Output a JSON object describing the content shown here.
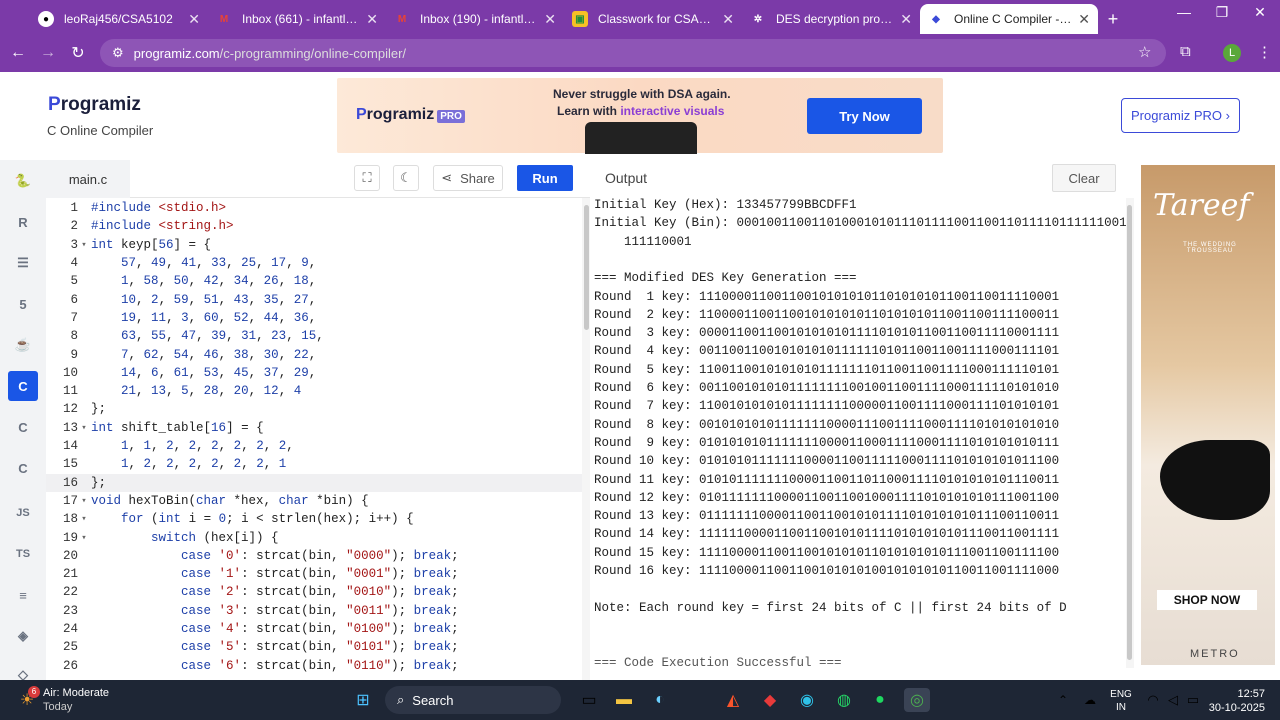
{
  "browser": {
    "tabs": [
      {
        "label": "leoRaj456/CSA5102",
        "icon": "github-icon"
      },
      {
        "label": "Inbox (661) - infantleoraj19",
        "icon": "gmail-icon"
      },
      {
        "label": "Inbox (190) - infantleoraj",
        "icon": "gmail-icon"
      },
      {
        "label": "Classwork for CSA5102_CN",
        "icon": "classroom-icon"
      },
      {
        "label": "DES decryption program",
        "icon": "chatgpt-icon"
      },
      {
        "label": "Online C Compiler - Progra",
        "icon": "programiz-icon"
      }
    ],
    "active_tab": 5,
    "url_domain": "programiz.com",
    "url_path": "/c-programming/online-compiler/",
    "profile_initial": "L"
  },
  "site": {
    "logo": "rogramiz",
    "logo_p": "P",
    "subtitle": "C Online Compiler",
    "pro_button": "Programiz PRO ›",
    "ad": {
      "logo": "rogramiz",
      "logo_p": "P",
      "pro": "PRO",
      "line1": "Never struggle with DSA again.",
      "line2_a": "Learn with ",
      "line2_b": "interactive visuals",
      "cta": "Try Now"
    }
  },
  "editor": {
    "filename": "main.c",
    "share": "Share",
    "run": "Run",
    "lines": [
      {
        "n": "1",
        "f": "",
        "html": "<span class='k'>#include</span> <span class='s'>&lt;stdio.h&gt;</span>"
      },
      {
        "n": "2",
        "f": "",
        "html": "<span class='k'>#include</span> <span class='s'>&lt;string.h&gt;</span>"
      },
      {
        "n": "3",
        "f": "▾",
        "html": "<span class='k'>int</span> keyp[<span class='n'>56</span>] = {"
      },
      {
        "n": "4",
        "f": "",
        "html": "    <span class='n'>57</span>, <span class='n'>49</span>, <span class='n'>41</span>, <span class='n'>33</span>, <span class='n'>25</span>, <span class='n'>17</span>, <span class='n'>9</span>,"
      },
      {
        "n": "5",
        "f": "",
        "html": "    <span class='n'>1</span>, <span class='n'>58</span>, <span class='n'>50</span>, <span class='n'>42</span>, <span class='n'>34</span>, <span class='n'>26</span>, <span class='n'>18</span>,"
      },
      {
        "n": "6",
        "f": "",
        "html": "    <span class='n'>10</span>, <span class='n'>2</span>, <span class='n'>59</span>, <span class='n'>51</span>, <span class='n'>43</span>, <span class='n'>35</span>, <span class='n'>27</span>,"
      },
      {
        "n": "7",
        "f": "",
        "html": "    <span class='n'>19</span>, <span class='n'>11</span>, <span class='n'>3</span>, <span class='n'>60</span>, <span class='n'>52</span>, <span class='n'>44</span>, <span class='n'>36</span>,"
      },
      {
        "n": "8",
        "f": "",
        "html": "    <span class='n'>63</span>, <span class='n'>55</span>, <span class='n'>47</span>, <span class='n'>39</span>, <span class='n'>31</span>, <span class='n'>23</span>, <span class='n'>15</span>,"
      },
      {
        "n": "9",
        "f": "",
        "html": "    <span class='n'>7</span>, <span class='n'>62</span>, <span class='n'>54</span>, <span class='n'>46</span>, <span class='n'>38</span>, <span class='n'>30</span>, <span class='n'>22</span>,"
      },
      {
        "n": "10",
        "f": "",
        "html": "    <span class='n'>14</span>, <span class='n'>6</span>, <span class='n'>61</span>, <span class='n'>53</span>, <span class='n'>45</span>, <span class='n'>37</span>, <span class='n'>29</span>,"
      },
      {
        "n": "11",
        "f": "",
        "html": "    <span class='n'>21</span>, <span class='n'>13</span>, <span class='n'>5</span>, <span class='n'>28</span>, <span class='n'>20</span>, <span class='n'>12</span>, <span class='n'>4</span>"
      },
      {
        "n": "12",
        "f": "",
        "html": "};"
      },
      {
        "n": "13",
        "f": "▾",
        "html": "<span class='k'>int</span> shift_table[<span class='n'>16</span>] = {"
      },
      {
        "n": "14",
        "f": "",
        "html": "    <span class='n'>1</span>, <span class='n'>1</span>, <span class='n'>2</span>, <span class='n'>2</span>, <span class='n'>2</span>, <span class='n'>2</span>, <span class='n'>2</span>, <span class='n'>2</span>,"
      },
      {
        "n": "15",
        "f": "",
        "html": "    <span class='n'>1</span>, <span class='n'>2</span>, <span class='n'>2</span>, <span class='n'>2</span>, <span class='n'>2</span>, <span class='n'>2</span>, <span class='n'>2</span>, <span class='n'>1</span>"
      },
      {
        "n": "16",
        "f": "",
        "html": "};"
      },
      {
        "n": "17",
        "f": "▾",
        "html": "<span class='k'>void</span> hexToBin(<span class='k'>char</span> *hex, <span class='k'>char</span> *bin) {"
      },
      {
        "n": "18",
        "f": "▾",
        "html": "    <span class='k'>for</span> (<span class='k'>int</span> i = <span class='n'>0</span>; i &lt; strlen(hex); i++) {"
      },
      {
        "n": "19",
        "f": "▾",
        "html": "        <span class='k'>switch</span> (hex[i]) {"
      },
      {
        "n": "20",
        "f": "",
        "html": "            <span class='k'>case</span> <span class='s'>'0'</span>: strcat(bin, <span class='s'>\"0000\"</span>); <span class='k'>break</span>;"
      },
      {
        "n": "21",
        "f": "",
        "html": "            <span class='k'>case</span> <span class='s'>'1'</span>: strcat(bin, <span class='s'>\"0001\"</span>); <span class='k'>break</span>;"
      },
      {
        "n": "22",
        "f": "",
        "html": "            <span class='k'>case</span> <span class='s'>'2'</span>: strcat(bin, <span class='s'>\"0010\"</span>); <span class='k'>break</span>;"
      },
      {
        "n": "23",
        "f": "",
        "html": "            <span class='k'>case</span> <span class='s'>'3'</span>: strcat(bin, <span class='s'>\"0011\"</span>); <span class='k'>break</span>;"
      },
      {
        "n": "24",
        "f": "",
        "html": "            <span class='k'>case</span> <span class='s'>'4'</span>: strcat(bin, <span class='s'>\"0100\"</span>); <span class='k'>break</span>;"
      },
      {
        "n": "25",
        "f": "",
        "html": "            <span class='k'>case</span> <span class='s'>'5'</span>: strcat(bin, <span class='s'>\"0101\"</span>); <span class='k'>break</span>;"
      },
      {
        "n": "26",
        "f": "",
        "html": "            <span class='k'>case</span> <span class='s'>'6'</span>: strcat(bin, <span class='s'>\"0110\"</span>); <span class='k'>break</span>;"
      }
    ],
    "highlighted_line": "16"
  },
  "output": {
    "label": "Output",
    "clear": "Clear",
    "lines": [
      "Initial Key (Hex): 133457799BBCDFF1",
      "Initial Key (Bin): 0001001100110100010101110111100110011011110111111001101111",
      "    111110001",
      "",
      "=== Modified DES Key Generation ===",
      "Round  1 key: 111000011001100101010101101010101100110011110001",
      "Round  2 key: 110000110011001010101011010101011001100111100011",
      "Round  3 key: 000011001100101010101111010101100110011110001111",
      "Round  4 key: 001100110010101010111111010110011001111000111101",
      "Round  5 key: 110011001010101011111110110011001111000111110101",
      "Round  6 key: 001100101010111111110010011001111000111110101010",
      "Round  7 key: 110010101010111111110000011001111000111101010101",
      "Round  8 key: 001010101011111110000111001111000111101010101010",
      "Round  9 key: 010101010111111100001100011110001111010101010111",
      "Round 10 key: 010101011111110000110011111000111101010101011100",
      "Round 11 key: 010101111111000011001101100011110101010101110011",
      "Round 12 key: 010111111100001100110010001111010101010111001100",
      "Round 13 key: 011111110000110011001010111101010101011100110011",
      "Round 14 key: 111111000011001100101011110101010101110011001111",
      "Round 15 key: 111100001100110010101011010101010111001100111100",
      "Round 16 key: 111100001100110010101010010101010110011001111000",
      "",
      "Note: Each round key = first 24 bits of C || first 24 bits of D",
      "",
      "",
      "=== Code Execution Successful ==="
    ]
  },
  "side_ad": {
    "brand": "Tareef",
    "tag": "THE WEDDING TROUSSEAU",
    "shop": "SHOP NOW",
    "footer": "METRO"
  },
  "taskbar": {
    "weather_title": "Air: Moderate",
    "weather_sub": "Today",
    "weather_badge": "6",
    "search": "Search",
    "lang1": "ENG",
    "lang2": "IN",
    "time": "12:57",
    "date": "30-10-2025"
  },
  "colors": {
    "accent": "#1a56e6",
    "browser": "#7b3aa8",
    "keyword": "#1d3fa8",
    "string": "#a31515"
  }
}
